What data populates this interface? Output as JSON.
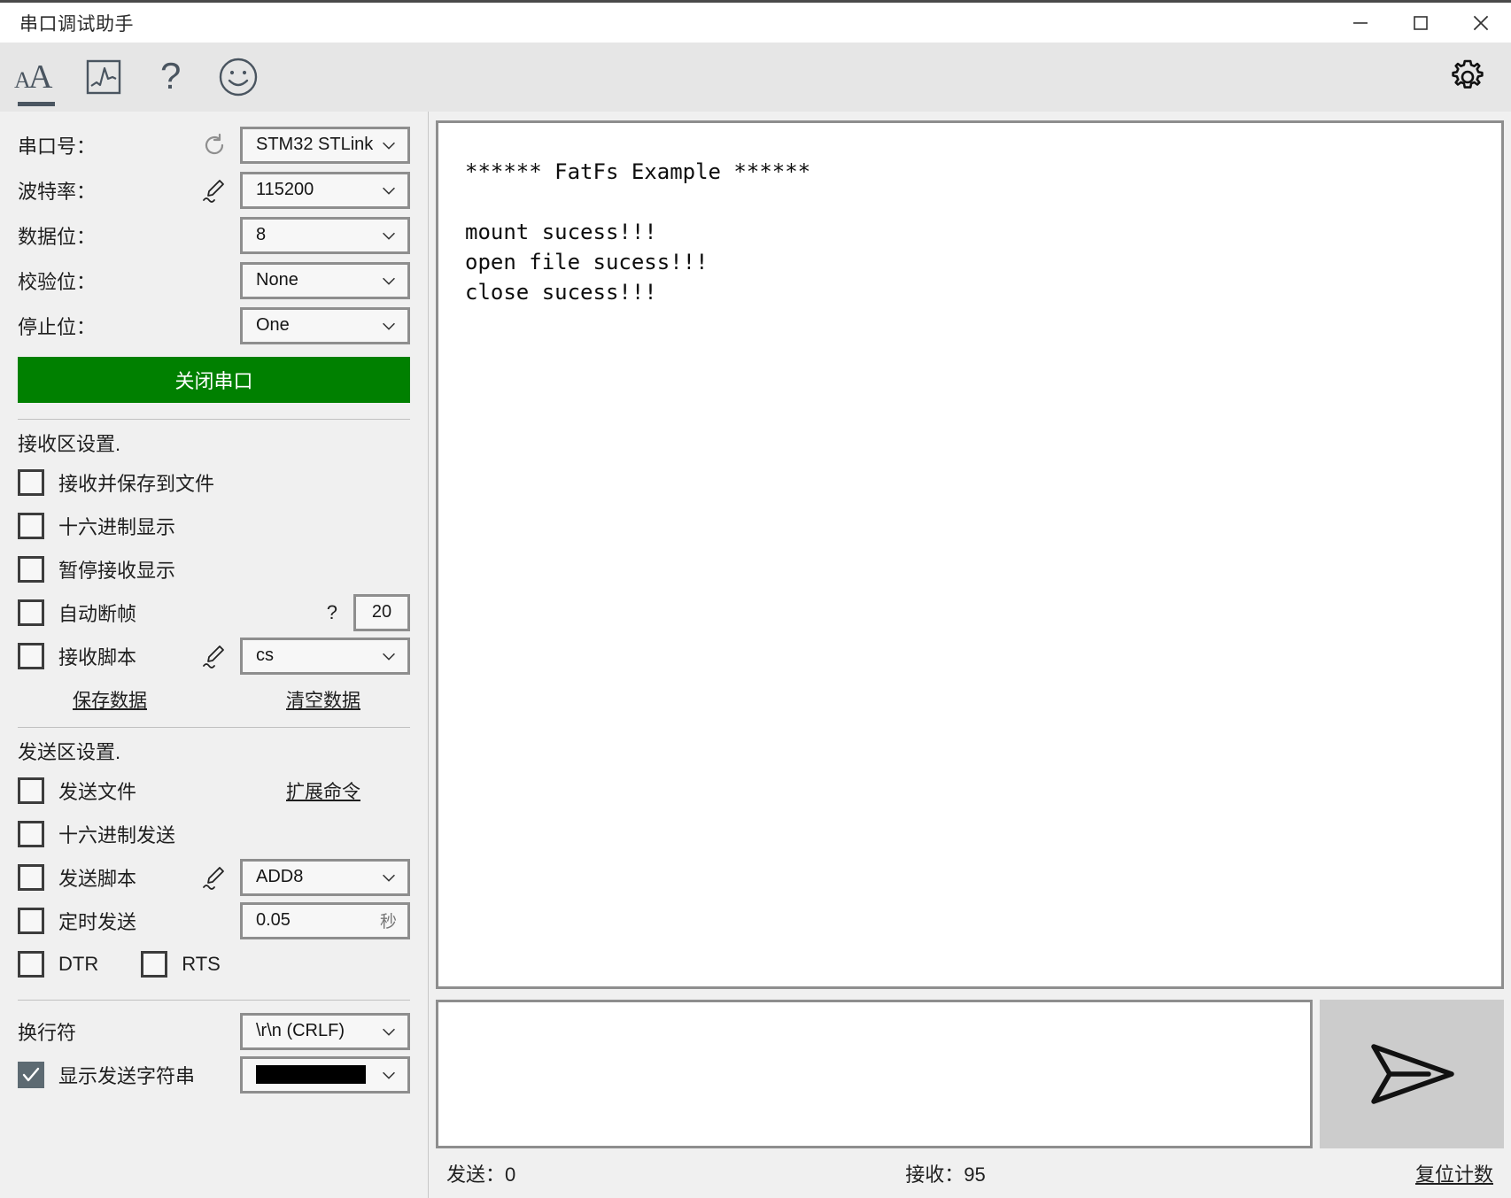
{
  "window": {
    "title": "串口调试助手",
    "controls": {
      "minimize": "minimize",
      "maximize": "maximize",
      "close": "close"
    }
  },
  "toolbar": {
    "items": [
      {
        "name": "text-mode",
        "icon": "font-size-icon",
        "active": true
      },
      {
        "name": "waveform-mode",
        "icon": "waveform-chart-icon",
        "active": false
      },
      {
        "name": "help",
        "icon": "question-mark-icon",
        "active": false
      },
      {
        "name": "about",
        "icon": "smiley-face-icon",
        "active": false
      }
    ],
    "settings_icon": "gear-icon"
  },
  "serial_settings": {
    "port": {
      "label": "串口号：",
      "value": "STM32 STLink",
      "refresh_icon": "refresh-icon"
    },
    "baud": {
      "label": "波特率：",
      "value": "115200",
      "edit_icon": "pen-edit-icon"
    },
    "data_bits": {
      "label": "数据位：",
      "value": "8"
    },
    "parity": {
      "label": "校验位：",
      "value": "None"
    },
    "stop_bits": {
      "label": "停止位：",
      "value": "One"
    },
    "connect_button": "关闭串口",
    "connect_button_color": "#008000"
  },
  "receive_settings": {
    "title": "接收区设置.",
    "save_to_file": {
      "label": "接收并保存到文件",
      "checked": false
    },
    "hex_display": {
      "label": "十六进制显示",
      "checked": false
    },
    "pause_display": {
      "label": "暂停接收显示",
      "checked": false
    },
    "auto_frame": {
      "label": "自动断帧",
      "checked": false,
      "help": "?",
      "value": "20"
    },
    "receive_script": {
      "label": "接收脚本",
      "checked": false,
      "edit_icon": "pen-edit-icon",
      "value": "cs"
    },
    "save_data_link": "保存数据",
    "clear_data_link": "清空数据"
  },
  "send_settings": {
    "title": "发送区设置.",
    "send_file": {
      "label": "发送文件",
      "checked": false
    },
    "extend_command_link": "扩展命令",
    "hex_send": {
      "label": "十六进制发送",
      "checked": false
    },
    "send_script": {
      "label": "发送脚本",
      "checked": false,
      "edit_icon": "pen-edit-icon",
      "value": "ADD8"
    },
    "timed_send": {
      "label": "定时发送",
      "checked": false,
      "value": "0.05",
      "unit": "秒"
    },
    "dtr": {
      "label": "DTR",
      "checked": false
    },
    "rts": {
      "label": "RTS",
      "checked": false
    }
  },
  "line_settings": {
    "newline": {
      "label": "换行符",
      "value": "\\r\\n (CRLF)"
    },
    "show_send_string": {
      "label": "显示发送字符串",
      "checked": true,
      "color_value": "#000000"
    }
  },
  "terminal": {
    "content": "****** FatFs Example ******\n\nmount sucess!!!\nopen file sucess!!!\nclose sucess!!!"
  },
  "send_box": {
    "value": "",
    "placeholder": "",
    "send_icon": "send-paper-plane-icon"
  },
  "statusbar": {
    "sent": "发送：0",
    "received": "接收：95",
    "reset_link": "复位计数"
  }
}
